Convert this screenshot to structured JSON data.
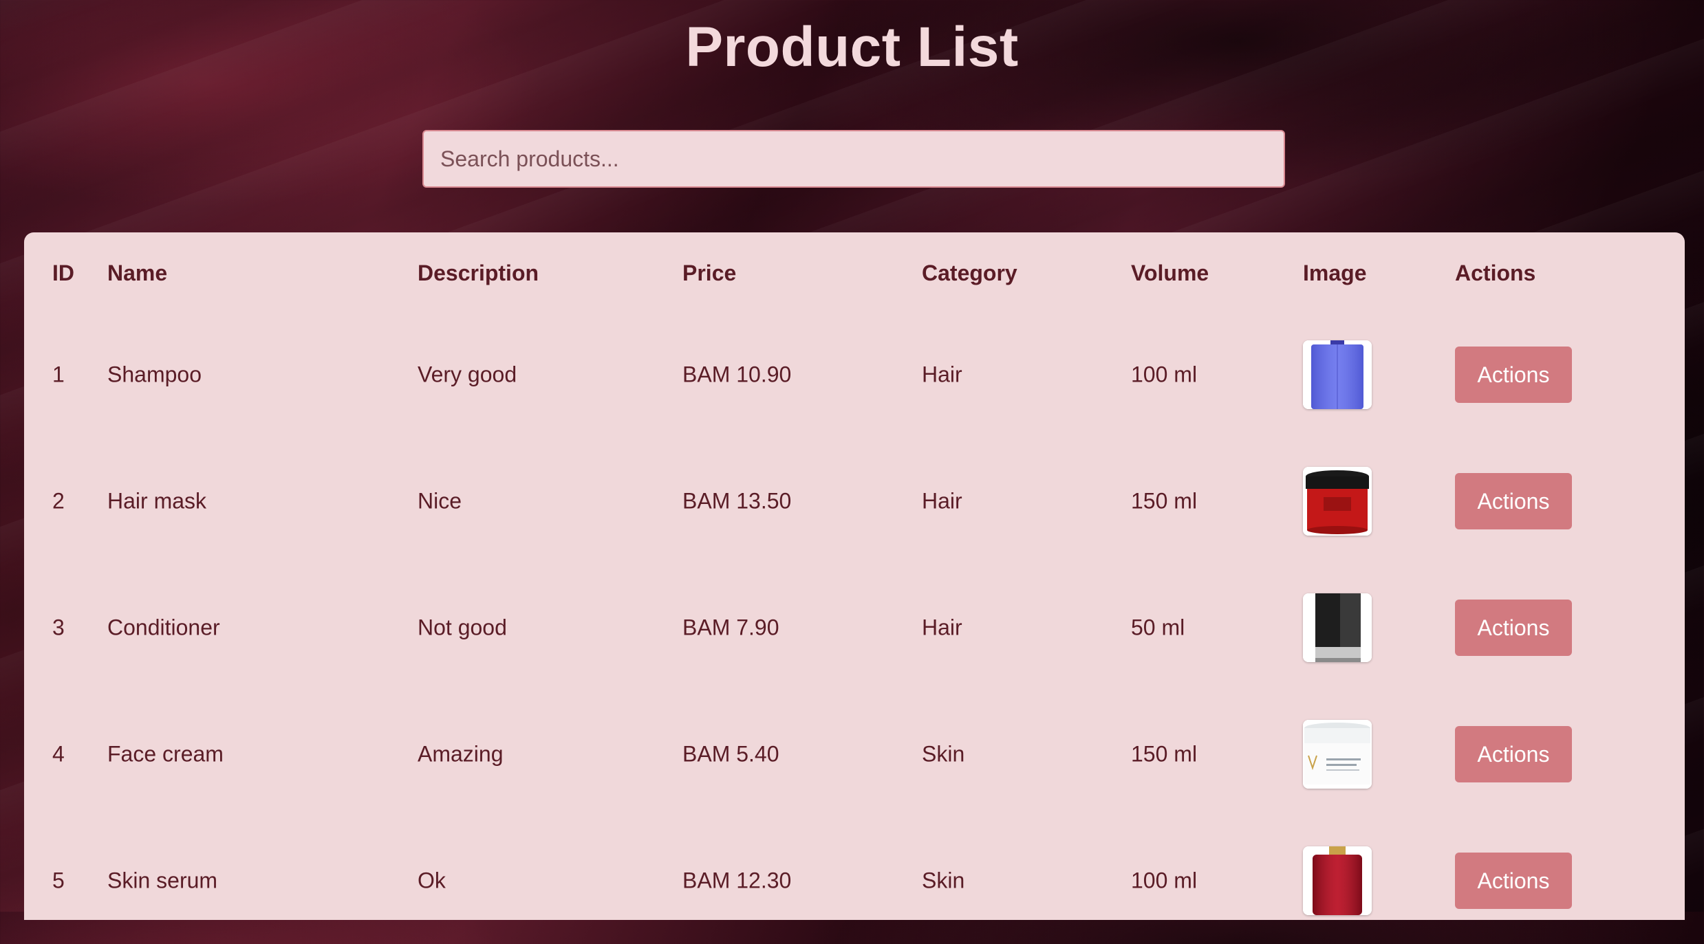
{
  "page": {
    "title": "Product List"
  },
  "search": {
    "placeholder": "Search products...",
    "value": ""
  },
  "table": {
    "headers": [
      "ID",
      "Name",
      "Description",
      "Price",
      "Category",
      "Volume",
      "Image",
      "Actions"
    ],
    "rows": [
      {
        "id": "1",
        "name": "Shampoo",
        "description": "Very good",
        "price": "BAM 10.90",
        "category": "Hair",
        "volume": "100 ml",
        "image_icon": "shampoo-bottle-image",
        "action_label": "Actions"
      },
      {
        "id": "2",
        "name": "Hair mask",
        "description": "Nice",
        "price": "BAM 13.50",
        "category": "Hair",
        "volume": "150 ml",
        "image_icon": "hair-mask-jar-image",
        "action_label": "Actions"
      },
      {
        "id": "3",
        "name": "Conditioner",
        "description": "Not good",
        "price": "BAM 7.90",
        "category": "Hair",
        "volume": "50 ml",
        "image_icon": "conditioner-tube-image",
        "action_label": "Actions"
      },
      {
        "id": "4",
        "name": "Face cream",
        "description": "Amazing",
        "price": "BAM 5.40",
        "category": "Skin",
        "volume": "150 ml",
        "image_icon": "face-cream-jar-image",
        "action_label": "Actions"
      },
      {
        "id": "5",
        "name": "Skin serum",
        "description": "Ok",
        "price": "BAM 12.30",
        "category": "Skin",
        "volume": "100 ml",
        "image_icon": "serum-bottle-image",
        "action_label": "Actions"
      }
    ]
  },
  "colors": {
    "panel_bg": "#f0d8da",
    "text": "#5a1c26",
    "button_bg": "#d27a80",
    "title": "#f3d9dc"
  }
}
